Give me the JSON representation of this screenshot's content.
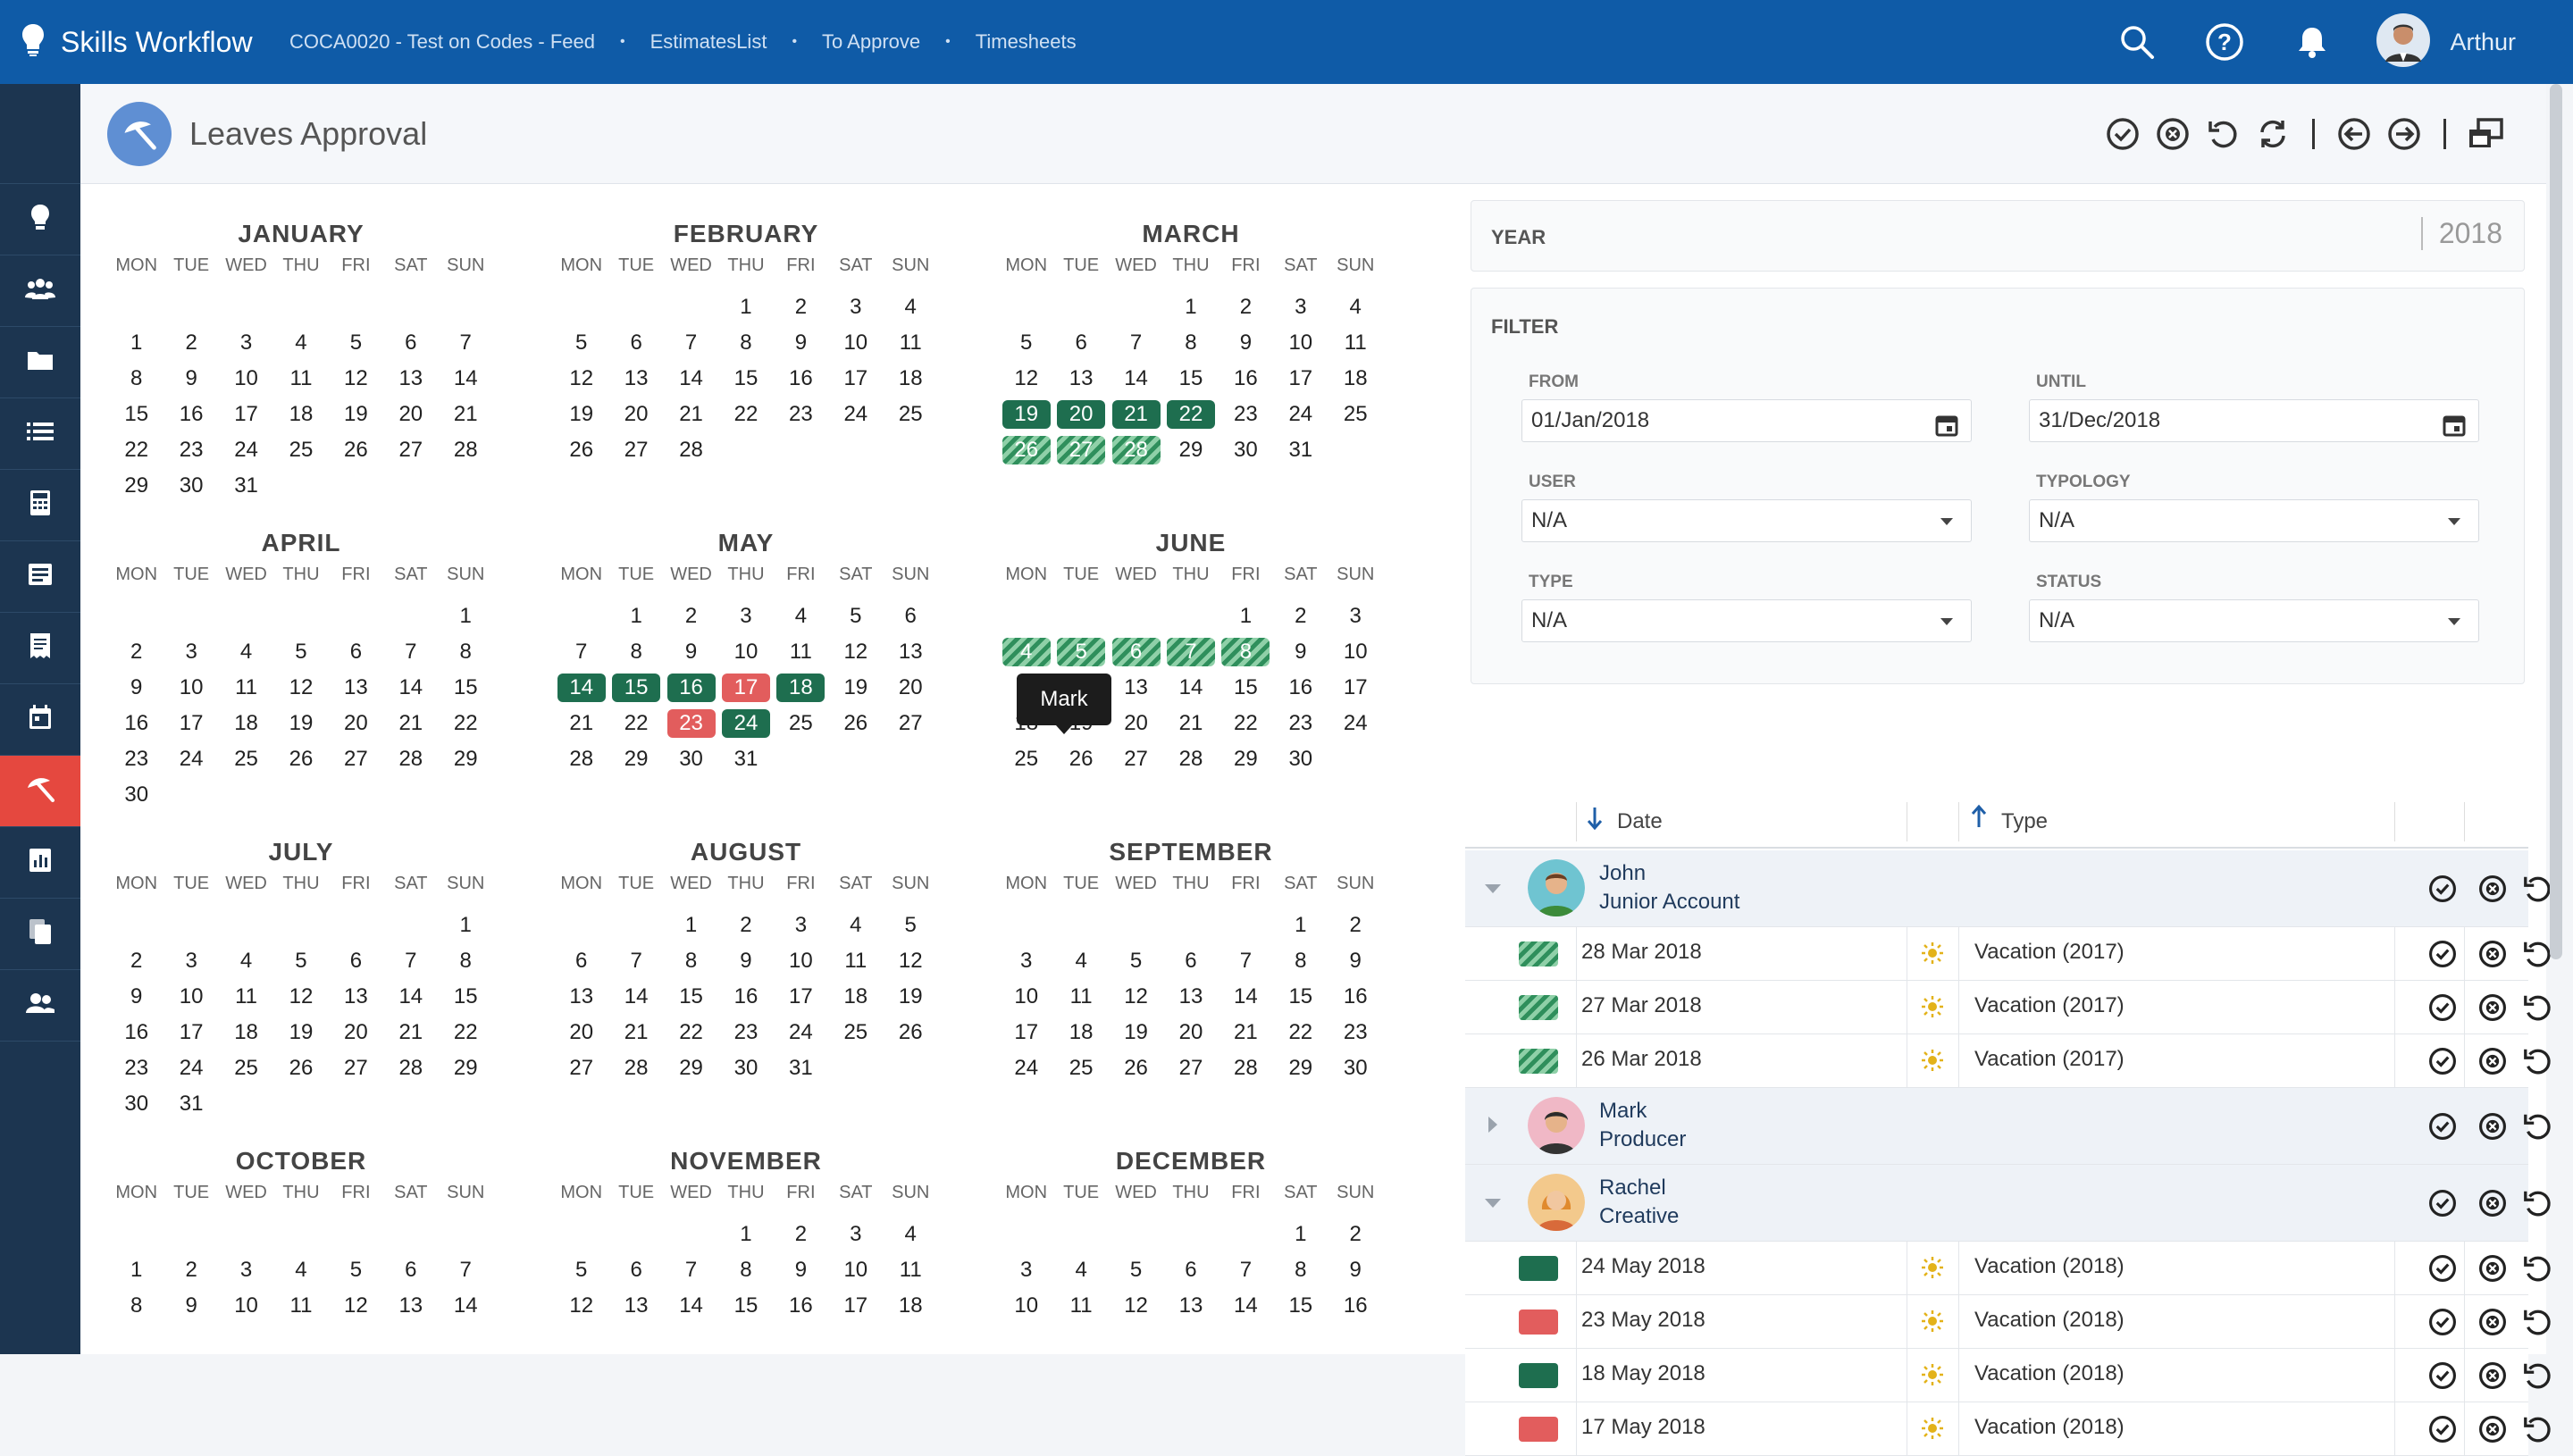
{
  "app": {
    "title": "Skills Workflow",
    "user": "Arthur"
  },
  "breadcrumbs": [
    "COCA0020 - Test on Codes - Feed",
    "EstimatesList",
    "To Approve",
    "Timesheets"
  ],
  "page": {
    "title": "Leaves Approval"
  },
  "calendar": {
    "dow": [
      "MON",
      "TUE",
      "WED",
      "THU",
      "FRI",
      "SAT",
      "SUN"
    ],
    "months": [
      {
        "name": "JANUARY",
        "weeks": [
          [
            "",
            "",
            "",
            "",
            "",
            "",
            ""
          ],
          [
            "1",
            "2",
            "3",
            "4",
            "5",
            "6",
            "7"
          ],
          [
            "8",
            "9",
            "10",
            "11",
            "12",
            "13",
            "14"
          ],
          [
            "15",
            "16",
            "17",
            "18",
            "19",
            "20",
            "21"
          ],
          [
            "22",
            "23",
            "24",
            "25",
            "26",
            "27",
            "28"
          ],
          [
            "29",
            "30",
            "31",
            "",
            "",
            "",
            ""
          ]
        ]
      },
      {
        "name": "FEBRUARY",
        "weeks": [
          [
            "",
            "",
            "",
            "1",
            "2",
            "3",
            "4"
          ],
          [
            "5",
            "6",
            "7",
            "8",
            "9",
            "10",
            "11"
          ],
          [
            "12",
            "13",
            "14",
            "15",
            "16",
            "17",
            "18"
          ],
          [
            "19",
            "20",
            "21",
            "22",
            "23",
            "24",
            "25"
          ],
          [
            "26",
            "27",
            "28",
            "",
            "",
            "",
            ""
          ]
        ]
      },
      {
        "name": "MARCH",
        "weeks": [
          [
            "",
            "",
            "",
            "1",
            "2",
            "3",
            "4"
          ],
          [
            "5",
            "6",
            "7",
            "8",
            "9",
            "10",
            "11"
          ],
          [
            "12",
            "13",
            "14",
            "15",
            "16",
            "17",
            "18"
          ],
          [
            "19",
            "20",
            "21",
            "22",
            "23",
            "24",
            "25"
          ],
          [
            "26",
            "27",
            "28",
            "29",
            "30",
            "31",
            ""
          ]
        ]
      },
      {
        "name": "APRIL",
        "weeks": [
          [
            "",
            "",
            "",
            "",
            "",
            "",
            "1"
          ],
          [
            "2",
            "3",
            "4",
            "5",
            "6",
            "7",
            "8"
          ],
          [
            "9",
            "10",
            "11",
            "12",
            "13",
            "14",
            "15"
          ],
          [
            "16",
            "17",
            "18",
            "19",
            "20",
            "21",
            "22"
          ],
          [
            "23",
            "24",
            "25",
            "26",
            "27",
            "28",
            "29"
          ],
          [
            "30",
            "",
            "",
            "",
            "",
            "",
            ""
          ]
        ]
      },
      {
        "name": "MAY",
        "weeks": [
          [
            "",
            "1",
            "2",
            "3",
            "4",
            "5",
            "6"
          ],
          [
            "7",
            "8",
            "9",
            "10",
            "11",
            "12",
            "13"
          ],
          [
            "14",
            "15",
            "16",
            "17",
            "18",
            "19",
            "20"
          ],
          [
            "21",
            "22",
            "23",
            "24",
            "25",
            "26",
            "27"
          ],
          [
            "28",
            "29",
            "30",
            "31",
            "",
            "",
            ""
          ]
        ]
      },
      {
        "name": "JUNE",
        "weeks": [
          [
            "",
            "",
            "",
            "",
            "1",
            "2",
            "3"
          ],
          [
            "4",
            "5",
            "6",
            "7",
            "8",
            "9",
            "10"
          ],
          [
            "11",
            "12",
            "13",
            "14",
            "15",
            "16",
            "17"
          ],
          [
            "18",
            "19",
            "20",
            "21",
            "22",
            "23",
            "24"
          ],
          [
            "25",
            "26",
            "27",
            "28",
            "29",
            "30",
            ""
          ]
        ]
      },
      {
        "name": "JULY",
        "weeks": [
          [
            "",
            "",
            "",
            "",
            "",
            "",
            "1"
          ],
          [
            "2",
            "3",
            "4",
            "5",
            "6",
            "7",
            "8"
          ],
          [
            "9",
            "10",
            "11",
            "12",
            "13",
            "14",
            "15"
          ],
          [
            "16",
            "17",
            "18",
            "19",
            "20",
            "21",
            "22"
          ],
          [
            "23",
            "24",
            "25",
            "26",
            "27",
            "28",
            "29"
          ],
          [
            "30",
            "31",
            "",
            "",
            "",
            "",
            ""
          ]
        ]
      },
      {
        "name": "AUGUST",
        "weeks": [
          [
            "",
            "",
            "1",
            "2",
            "3",
            "4",
            "5"
          ],
          [
            "6",
            "7",
            "8",
            "9",
            "10",
            "11",
            "12"
          ],
          [
            "13",
            "14",
            "15",
            "16",
            "17",
            "18",
            "19"
          ],
          [
            "20",
            "21",
            "22",
            "23",
            "24",
            "25",
            "26"
          ],
          [
            "27",
            "28",
            "29",
            "30",
            "31",
            "",
            ""
          ]
        ]
      },
      {
        "name": "SEPTEMBER",
        "weeks": [
          [
            "",
            "",
            "",
            "",
            "",
            "1",
            "2"
          ],
          [
            "3",
            "4",
            "5",
            "6",
            "7",
            "8",
            "9"
          ],
          [
            "10",
            "11",
            "12",
            "13",
            "14",
            "15",
            "16"
          ],
          [
            "17",
            "18",
            "19",
            "20",
            "21",
            "22",
            "23"
          ],
          [
            "24",
            "25",
            "26",
            "27",
            "28",
            "29",
            "30"
          ]
        ]
      },
      {
        "name": "OCTOBER",
        "weeks": [
          [
            "",
            "",
            "",
            "",
            "",
            "",
            ""
          ],
          [
            "1",
            "2",
            "3",
            "4",
            "5",
            "6",
            "7"
          ],
          [
            "8",
            "9",
            "10",
            "11",
            "12",
            "13",
            "14"
          ]
        ]
      },
      {
        "name": "NOVEMBER",
        "weeks": [
          [
            "",
            "",
            "",
            "1",
            "2",
            "3",
            "4"
          ],
          [
            "5",
            "6",
            "7",
            "8",
            "9",
            "10",
            "11"
          ],
          [
            "12",
            "13",
            "14",
            "15",
            "16",
            "17",
            "18"
          ]
        ]
      },
      {
        "name": "DECEMBER",
        "weeks": [
          [
            "",
            "",
            "",
            "",
            "",
            "1",
            "2"
          ],
          [
            "3",
            "4",
            "5",
            "6",
            "7",
            "8",
            "9"
          ],
          [
            "10",
            "11",
            "12",
            "13",
            "14",
            "15",
            "16"
          ]
        ]
      }
    ],
    "highlights": {
      "MARCH": {
        "19": "approved",
        "20": "approved",
        "21": "approved",
        "22": "approved",
        "26": "pending",
        "27": "pending",
        "28": "pending"
      },
      "MAY": {
        "14": "approved",
        "15": "approved",
        "16": "approved",
        "17": "rejected",
        "18": "approved",
        "23": "rejected",
        "24": "approved"
      },
      "JUNE": {
        "4": "pending",
        "5": "pending",
        "6": "pending",
        "7": "pending",
        "8": "pending"
      }
    },
    "tooltip": "Mark"
  },
  "year": {
    "label": "YEAR",
    "value": "2018"
  },
  "filter": {
    "title": "FILTER",
    "from_label": "FROM",
    "from_value": "01/Jan/2018",
    "until_label": "UNTIL",
    "until_value": "31/Dec/2018",
    "user_label": "USER",
    "user_value": "N/A",
    "typology_label": "TYPOLOGY",
    "typology_value": "N/A",
    "type_label": "TYPE",
    "type_value": "N/A",
    "status_label": "STATUS",
    "status_value": "N/A"
  },
  "grid": {
    "col_date": "Date",
    "col_type": "Type",
    "groups": [
      {
        "name": "John",
        "role": "Junior Account",
        "expanded": true,
        "items": [
          {
            "date": "28 Mar 2018",
            "type": "Vacation (2017)",
            "status": "pending"
          },
          {
            "date": "27 Mar 2018",
            "type": "Vacation (2017)",
            "status": "pending"
          },
          {
            "date": "26 Mar 2018",
            "type": "Vacation (2017)",
            "status": "pending"
          }
        ]
      },
      {
        "name": "Mark",
        "role": "Producer",
        "expanded": false,
        "items": []
      },
      {
        "name": "Rachel",
        "role": "Creative",
        "expanded": true,
        "items": [
          {
            "date": "24 May 2018",
            "type": "Vacation (2018)",
            "status": "approved"
          },
          {
            "date": "23 May 2018",
            "type": "Vacation (2018)",
            "status": "rejected"
          },
          {
            "date": "18 May 2018",
            "type": "Vacation (2018)",
            "status": "approved"
          },
          {
            "date": "17 May 2018",
            "type": "Vacation (2018)",
            "status": "rejected"
          }
        ]
      }
    ]
  },
  "colors": {
    "topbar": "#0f5ba7",
    "sidebar": "#1c3550",
    "active": "#e5483f",
    "approved": "#1e6e4f",
    "rejected": "#e25d5d"
  }
}
